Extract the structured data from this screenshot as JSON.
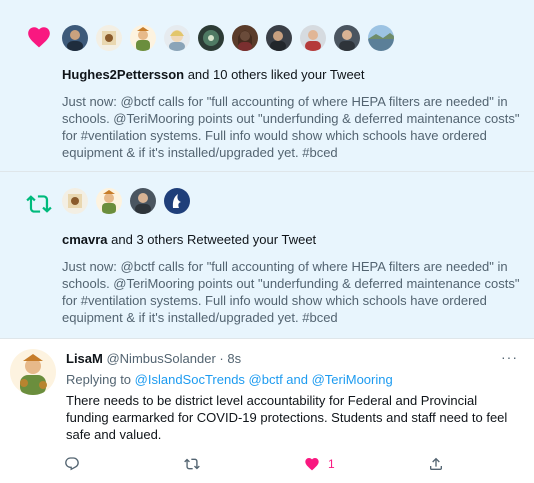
{
  "notifications": [
    {
      "type": "like",
      "icon": "heart-icon",
      "color": "#f91880",
      "actor": "Hughes2Pettersson",
      "rest": " and 10 others liked your Tweet",
      "tweet_text": "Just now: @bctf calls for \"full accounting of where HEPA filters are needed\" in schools. @TeriMooring points out \"underfunding & deferred maintenance costs\" for #ventilation systems. Full info would show which schools have ordered equipment & if it's installed/upgraded yet. #bced"
    },
    {
      "type": "retweet",
      "icon": "retweet-icon",
      "color": "#00ba7c",
      "actor": "cmavra",
      "rest": " and 3 others Retweeted your Tweet",
      "tweet_text": "Just now: @bctf calls for \"full accounting of where HEPA filters are needed\" in schools. @TeriMooring points out \"underfunding & deferred maintenance costs\" for #ventilation systems. Full info would show which schools have ordered equipment & if it's installed/upgraded yet. #bced"
    }
  ],
  "reply_tweet": {
    "name": "LisaM",
    "handle": "@NimbusSolander",
    "time": " · 8s",
    "more": "···",
    "replying_prefix": "Replying to ",
    "replying_links": "@IslandSocTrends @bctf and @TeriMooring",
    "text": "There needs to be district level accountability for Federal and Provincial funding earmarked for COVID-19 protections. Students and staff need to feel safe and valued.",
    "like_count": "1"
  },
  "colors": {
    "accent": "#1d9bf0",
    "like": "#f91880",
    "retweet": "#00ba7c",
    "background": "#e8f5fd"
  }
}
